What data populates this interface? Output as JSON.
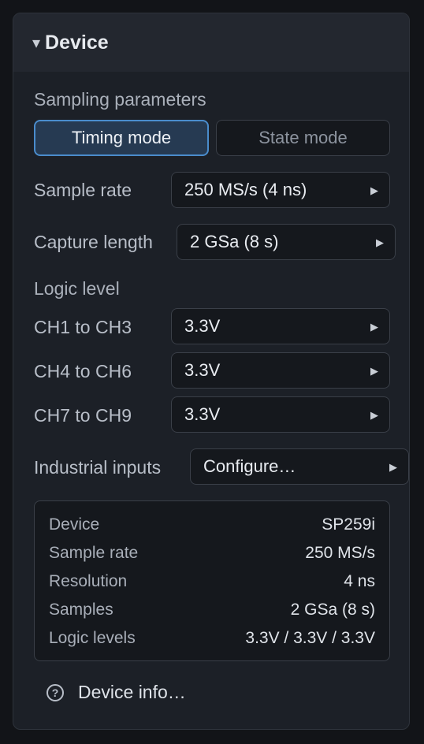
{
  "panel": {
    "title": "Device",
    "caret_icon": "caret-down-icon"
  },
  "sampling": {
    "section_label": "Sampling parameters",
    "modes": [
      {
        "label": "Timing mode",
        "active": true
      },
      {
        "label": "State mode",
        "active": false
      }
    ],
    "sample_rate": {
      "label": "Sample rate",
      "value": "250 MS/s (4 ns)"
    },
    "capture_length": {
      "label": "Capture length",
      "value": "2 GSa (8 s)"
    }
  },
  "logic": {
    "section_label": "Logic level",
    "groups": [
      {
        "label": "CH1 to CH3",
        "value": "3.3V"
      },
      {
        "label": "CH4 to CH6",
        "value": "3.3V"
      },
      {
        "label": "CH7 to CH9",
        "value": "3.3V"
      }
    ]
  },
  "industrial": {
    "label": "Industrial inputs",
    "value": "Configure…"
  },
  "summary": {
    "rows": [
      {
        "key": "Device",
        "value": "SP259i"
      },
      {
        "key": "Sample rate",
        "value": "250 MS/s"
      },
      {
        "key": "Resolution",
        "value": "4 ns"
      },
      {
        "key": "Samples",
        "value": "2 GSa (8 s)"
      },
      {
        "key": "Logic levels",
        "value": "3.3V / 3.3V / 3.3V"
      }
    ]
  },
  "device_info": {
    "label": "Device info…",
    "icon": "help-circle-icon"
  },
  "colors": {
    "accent": "#4a8ccc",
    "panel_bg": "#1c2027",
    "header_bg": "#23272f",
    "field_bg": "#15181d"
  }
}
